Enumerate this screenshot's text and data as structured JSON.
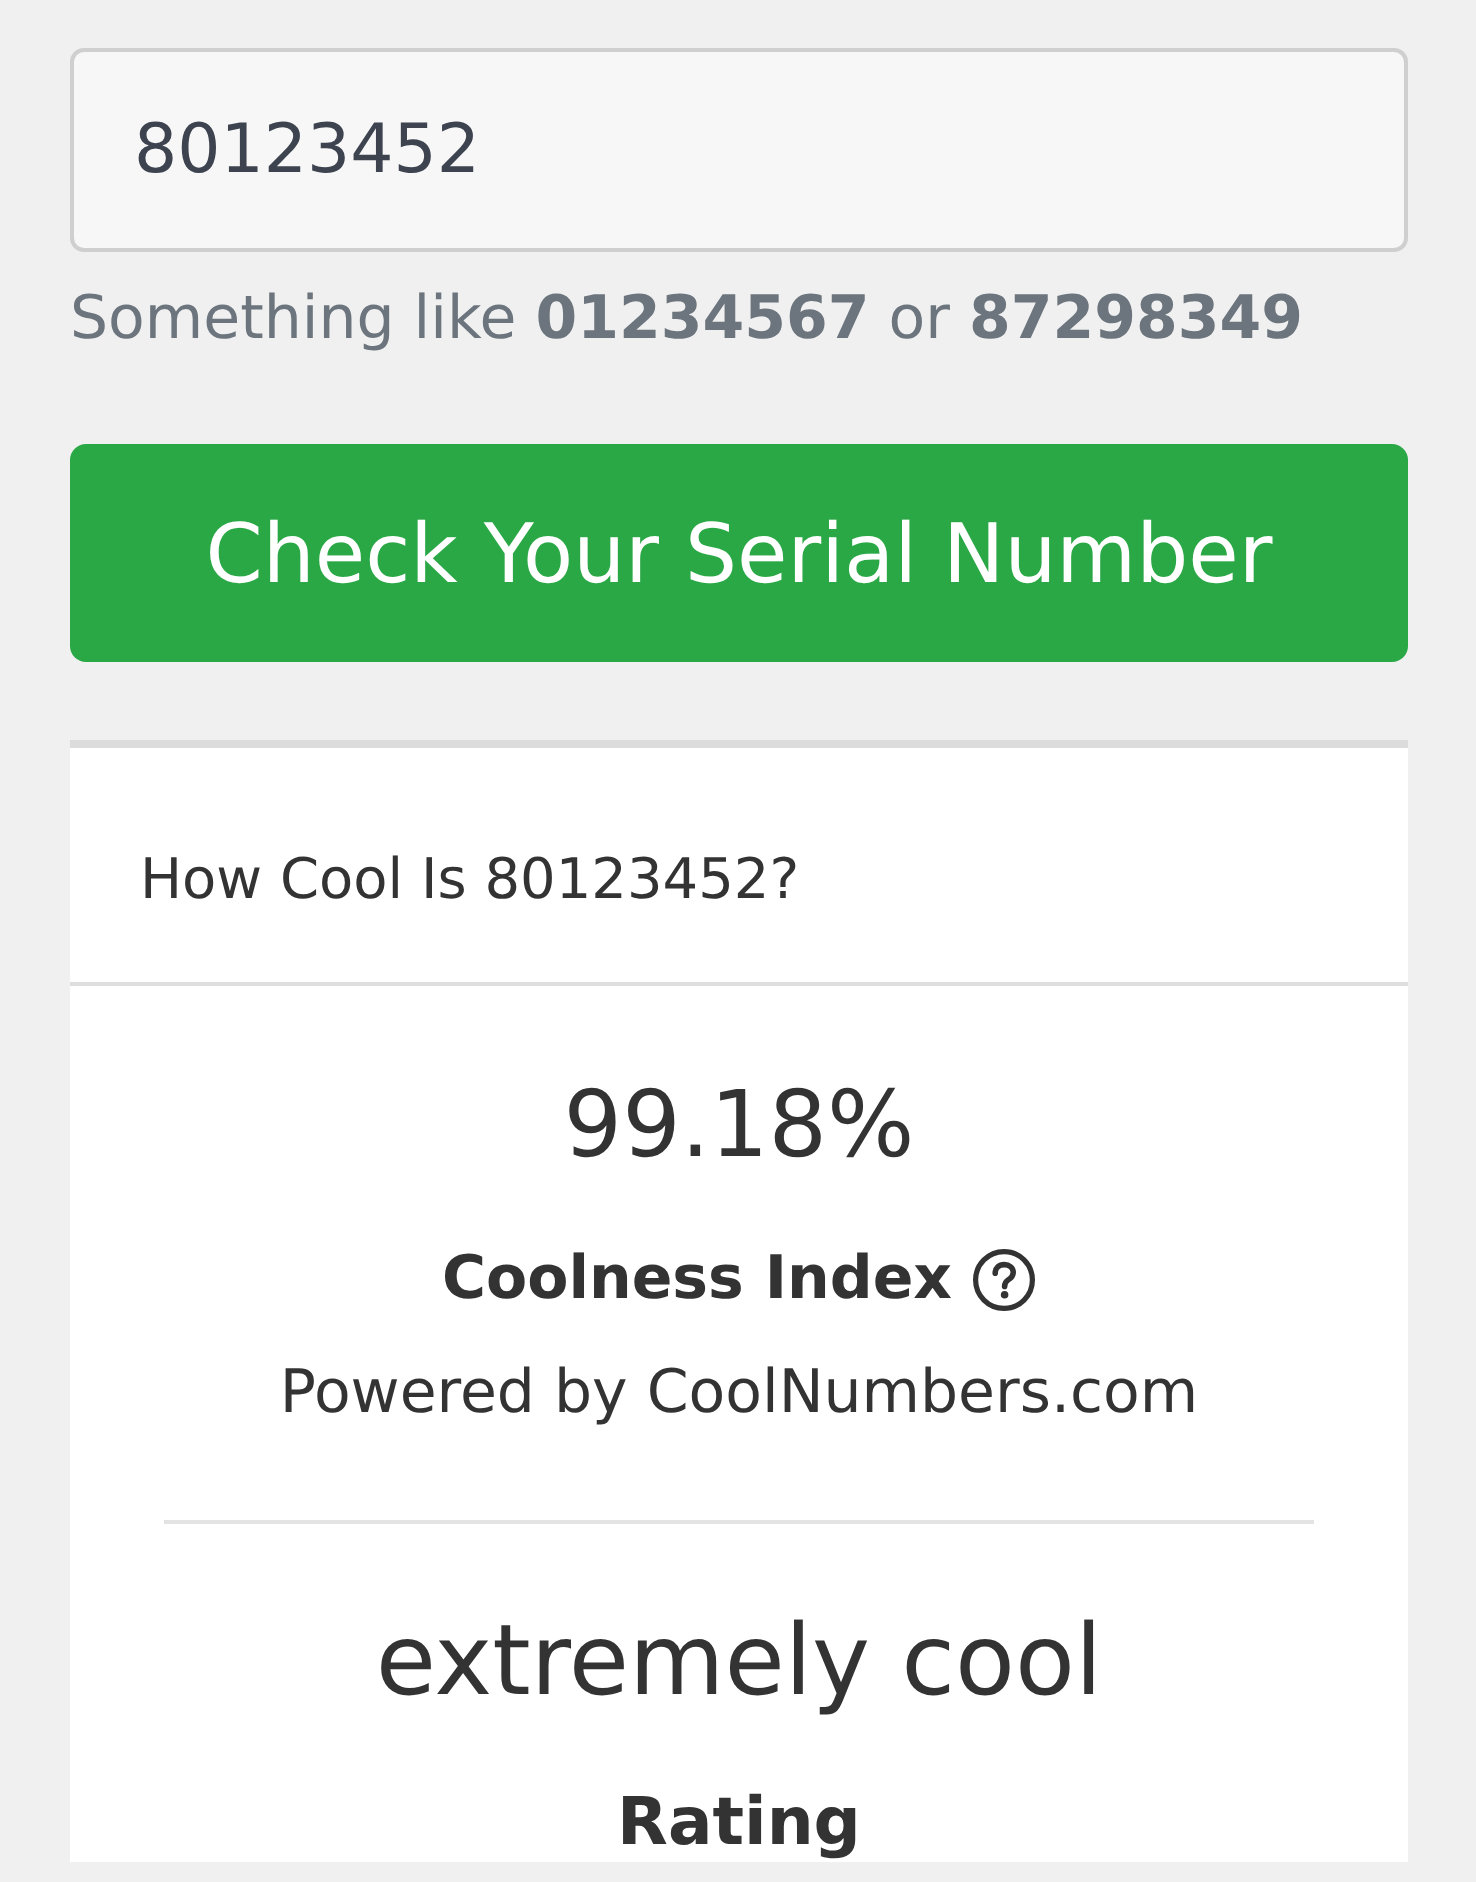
{
  "serial_input": {
    "value": "80123452"
  },
  "hint": "Something like **01234567** or **87298349**",
  "check_button": {
    "label": "Check Your Serial Number"
  },
  "result_card": {
    "header": "How Cool Is 80123452?",
    "coolness": {
      "value": "99.18%",
      "label": "Coolness Index",
      "powered_by": "Powered by CoolNumbers.com"
    },
    "rating": {
      "value": "extremely cool",
      "label": "Rating"
    }
  }
}
